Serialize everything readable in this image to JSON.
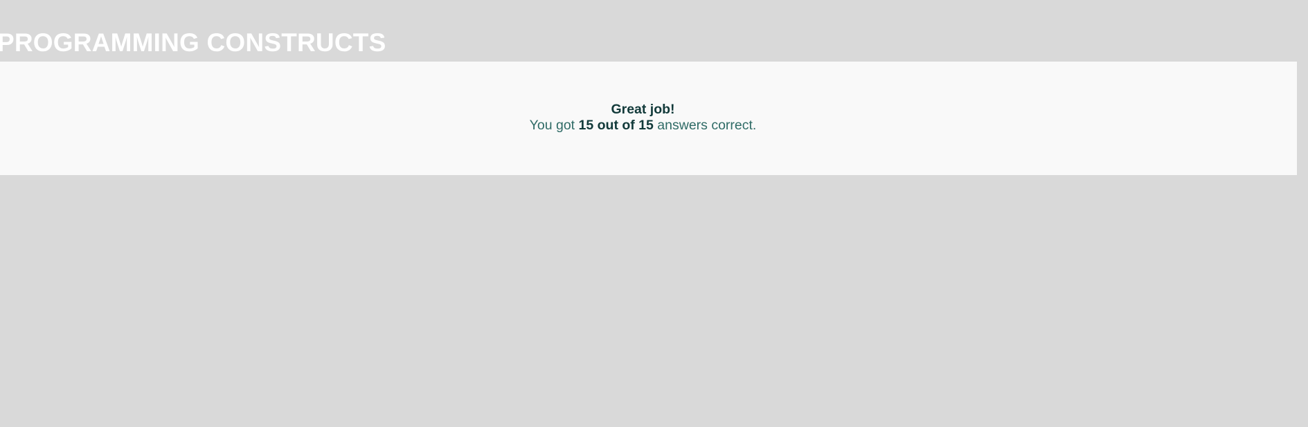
{
  "page": {
    "title": "PROGRAMMING CONSTRUCTS"
  },
  "result": {
    "headline": "Great job!",
    "prefix": "You got",
    "score": "15 out of 15",
    "suffix": "answers correct."
  },
  "colors": {
    "background": "#d9d9d9",
    "panel": "#f9f9f9",
    "title": "#ffffff",
    "text": "#2f6b66",
    "emphasis": "#123a3a"
  }
}
